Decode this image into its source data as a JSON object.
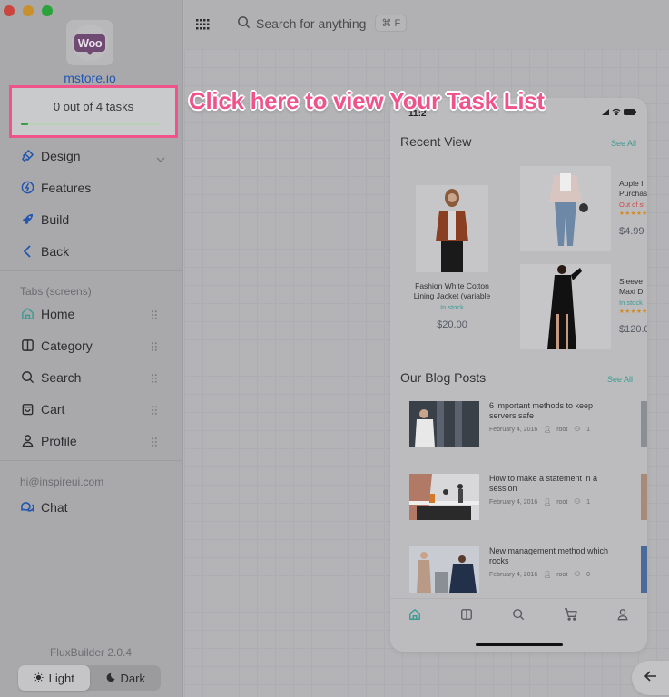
{
  "window": {
    "controls": [
      "close",
      "minimize",
      "maximize"
    ]
  },
  "sidebar": {
    "logo": {
      "text": "Woo",
      "icon": "woocommerce-logo"
    },
    "store_name": "mstore.io",
    "tasks": {
      "label": "0 out of 4 tasks",
      "completed": 0,
      "total": 4,
      "progress_percent": 5
    },
    "main_nav": [
      {
        "label": "Design",
        "icon": "brush-icon",
        "has_chevron": true
      },
      {
        "label": "Features",
        "icon": "bolt-circle-icon"
      },
      {
        "label": "Build",
        "icon": "rocket-icon"
      },
      {
        "label": "Back",
        "icon": "chevron-left-icon"
      }
    ],
    "tabs_section_label": "Tabs (screens)",
    "tabs": [
      {
        "label": "Home",
        "icon": "home-icon",
        "active": true
      },
      {
        "label": "Category",
        "icon": "category-icon"
      },
      {
        "label": "Search",
        "icon": "search-icon"
      },
      {
        "label": "Cart",
        "icon": "cart-icon"
      },
      {
        "label": "Profile",
        "icon": "profile-icon"
      }
    ],
    "contact_email": "hi@inspireui.com",
    "chat_label": "Chat",
    "version": "FluxBuilder 2.0.4",
    "theme": {
      "light_label": "Light",
      "dark_label": "Dark",
      "selected": "Light"
    }
  },
  "topbar": {
    "search_placeholder": "Search for anything",
    "shortcut": "⌘ F"
  },
  "callout": "Click here to view Your Task List",
  "phone": {
    "status_time": "11:2",
    "recent_view": {
      "title": "Recent View",
      "see_all": "See All",
      "products": [
        {
          "name_line1": "Fashion White Cotton",
          "name_line2": "Lining Jacket (variable",
          "stock": "In stock",
          "price": "$20.00"
        },
        {
          "name_line1": "Apple I",
          "name_line2": "Purchas",
          "stock": "Out of st",
          "rating": "★★★★★",
          "price": "$4.99"
        },
        {
          "name_line1": "Sleeve",
          "name_line2": "Maxi D",
          "stock": "In stock",
          "rating": "★★★★★",
          "price": "$120.0"
        }
      ]
    },
    "blog": {
      "title": "Our Blog Posts",
      "see_all": "See All",
      "posts": [
        {
          "title": "6 important methods to keep servers safe",
          "date": "February 4, 2016",
          "author": "root",
          "comments": "1"
        },
        {
          "title": "How to make a statement in a session",
          "date": "February 4, 2016",
          "author": "root",
          "comments": "1"
        },
        {
          "title": "New management method which rocks",
          "date": "February 4, 2016",
          "author": "root",
          "comments": "0"
        }
      ]
    },
    "tabbar": [
      "home-icon",
      "category-icon",
      "search-icon",
      "cart-icon",
      "profile-icon"
    ]
  },
  "colors": {
    "accent_pink": "#f0538a",
    "teal": "#3c9a93",
    "link_blue": "#2356b0",
    "progress_green": "#3b9a46"
  }
}
